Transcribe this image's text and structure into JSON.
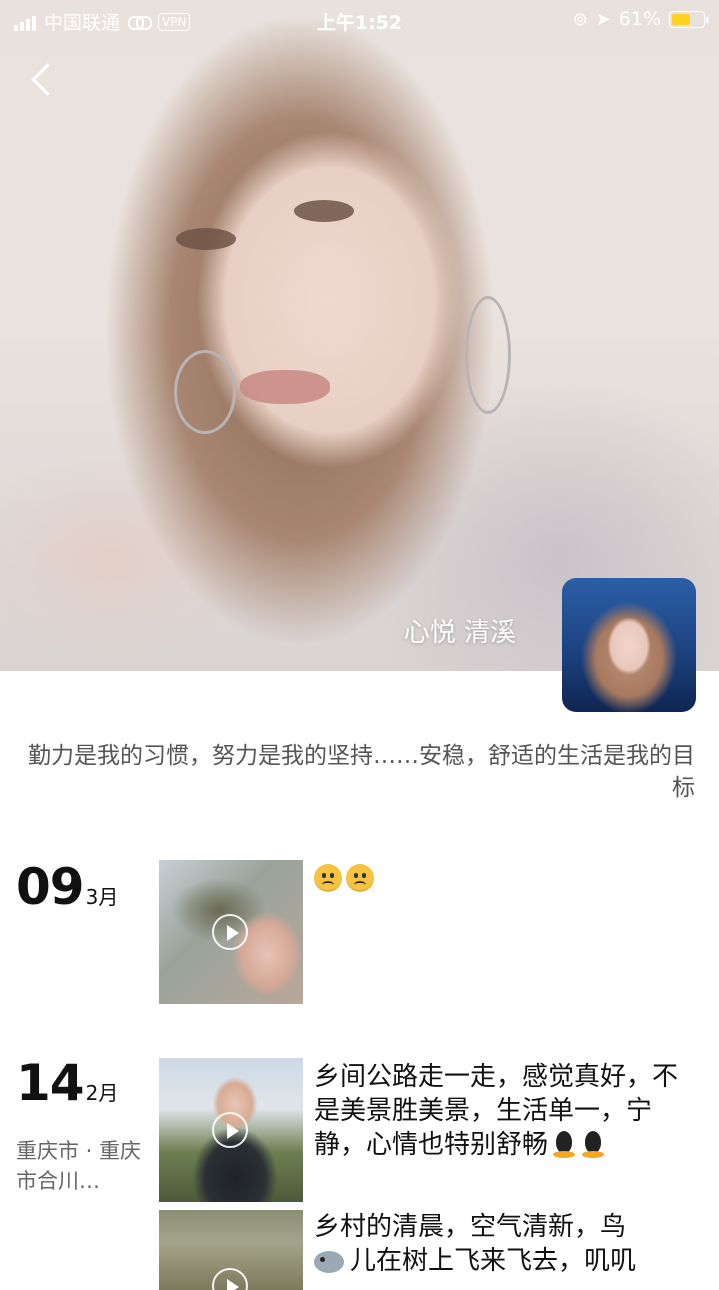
{
  "status": {
    "carrier": "中国联通",
    "vpn": "VPN",
    "time": "上午1:52",
    "battery_text": "61%",
    "battery_level": 0.61,
    "battery_color": "#ffd21f"
  },
  "profile": {
    "name": "心悦 清溪",
    "bio": "勤力是我的习惯，努力是我的坚持……安稳，舒适的生活是我的目标"
  },
  "posts": [
    {
      "day": "09",
      "month": "3月",
      "location": "",
      "text": "",
      "emoji": [
        "frown-icon",
        "frown-icon"
      ]
    },
    {
      "day": "14",
      "month": "2月",
      "location": "重庆市 · 重庆市合川…",
      "text": "乡间公路走一走，感觉真好，不是美景胜美景，生活单一，宁静，心情也特别舒畅",
      "emoji": [
        "qq-penguin-icon",
        "qq-penguin-icon"
      ]
    },
    {
      "text_line1": "乡村的清晨，空气清新，鸟",
      "text_line2": "儿在树上飞来飞去，叽叽"
    }
  ]
}
